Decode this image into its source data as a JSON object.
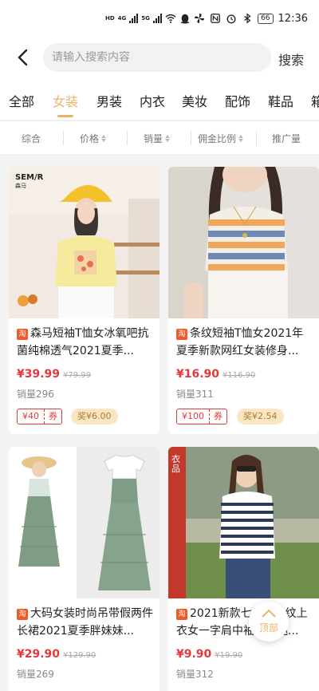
{
  "status_bar": {
    "network_1": "4G",
    "network_2": "5G",
    "hd1": "HD",
    "hd2": "HD",
    "battery": "66",
    "time": "12:36",
    "icons": [
      "signal-icon",
      "wifi-icon",
      "qq-icon",
      "pinwheel-icon",
      "nfc-icon",
      "alarm-icon",
      "bluetooth-icon"
    ]
  },
  "search": {
    "placeholder": "请输入搜索内容",
    "button": "搜索"
  },
  "categories": [
    "全部",
    "女装",
    "男装",
    "内衣",
    "美妆",
    "配饰",
    "鞋品",
    "箱"
  ],
  "active_category": "女装",
  "sorts": [
    "综合",
    "价格",
    "销量",
    "佣金比例",
    "推广量"
  ],
  "products": [
    {
      "platform": "淘",
      "title": "森马短袖T恤女冰氧吧抗菌纯棉透气2021夏季...",
      "image_brand": "SEM/R",
      "image_brand_sub": "森马",
      "price": "¥39.99",
      "original_price": "¥79.99",
      "sales": "销量296",
      "coupon_value": "¥40",
      "coupon_label": "券",
      "reward": "奖¥6.00"
    },
    {
      "platform": "淘",
      "title": "条纹短袖T恤女2021年夏季新款网红女装修身...",
      "price": "¥16.90",
      "original_price": "¥116.90",
      "sales": "销量311",
      "coupon_value": "¥100",
      "coupon_label": "券",
      "reward": "奖¥2.54"
    },
    {
      "platform": "淘",
      "title": "大码女装时尚吊带假两件长裙2021夏季胖妹妹...",
      "price": "¥29.90",
      "original_price": "¥129.90",
      "sales": "销量269"
    },
    {
      "platform": "淘",
      "title": "2021新款七分袖条纹上衣女一字肩中袖上衣纯...",
      "image_brand": "衣品",
      "price": "¥9.90",
      "original_price": "¥19.90",
      "sales": "销量312"
    }
  ],
  "back_to_top": "顶部",
  "colors": {
    "accent": "#e9b46a",
    "price": "#e5383b",
    "reward_bg": "#fbe6c4"
  }
}
